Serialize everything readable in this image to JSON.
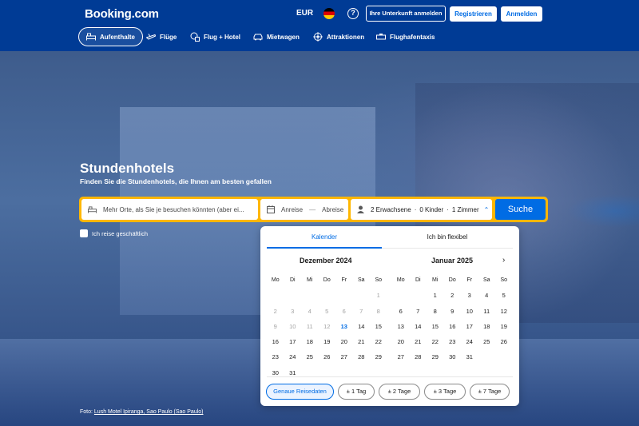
{
  "header": {
    "logo": "Booking.com",
    "currency": "EUR",
    "help": "?",
    "list_property": "Ihre Unterkunft anmelden",
    "register": "Registrieren",
    "login": "Anmelden"
  },
  "nav": {
    "items": [
      {
        "label": "Aufenthalte",
        "icon": "bed-icon",
        "active": true
      },
      {
        "label": "Flüge",
        "icon": "plane-icon"
      },
      {
        "label": "Flug + Hotel",
        "icon": "flight-hotel-icon"
      },
      {
        "label": "Mietwagen",
        "icon": "car-icon"
      },
      {
        "label": "Attraktionen",
        "icon": "attraction-icon"
      },
      {
        "label": "Flughafentaxis",
        "icon": "taxi-icon"
      }
    ]
  },
  "hero": {
    "title": "Stundenhotels",
    "subtitle": "Finden Sie die Stundenhotels, die Ihnen am besten gefallen"
  },
  "search": {
    "destination_placeholder": "Mehr Orte, als Sie je besuchen könnten (aber ei...",
    "checkin": "Anreise",
    "dash": "—",
    "checkout": "Abreise",
    "adults": "2 Erwachsene",
    "dot1": "·",
    "children": "0 Kinder",
    "dot2": "·",
    "rooms": "1 Zimmer",
    "button": "Suche",
    "business_label": "Ich reise geschäftlich"
  },
  "calendar": {
    "tab_calendar": "Kalender",
    "tab_flexible": "Ich bin flexibel",
    "weekdays": [
      "Mo",
      "Di",
      "Mi",
      "Do",
      "Fr",
      "Sa",
      "So"
    ],
    "months": [
      {
        "title": "Dezember 2024",
        "offset": 6,
        "days": 31,
        "today": 13
      },
      {
        "title": "Januar 2025",
        "offset": 2,
        "days": 31,
        "today": null
      }
    ],
    "chips": [
      "Genaue Reisedaten",
      "± 1 Tag",
      "± 2 Tage",
      "± 3 Tage",
      "± 7 Tage"
    ]
  },
  "photo_credit": {
    "prefix": "Foto: ",
    "link": "Lush Motel Ipiranga, Sao Paulo (Sao Paulo)"
  },
  "colors": {
    "brand_blue": "#003b95",
    "accent_blue": "#006ce4",
    "search_border": "#ffb700"
  }
}
